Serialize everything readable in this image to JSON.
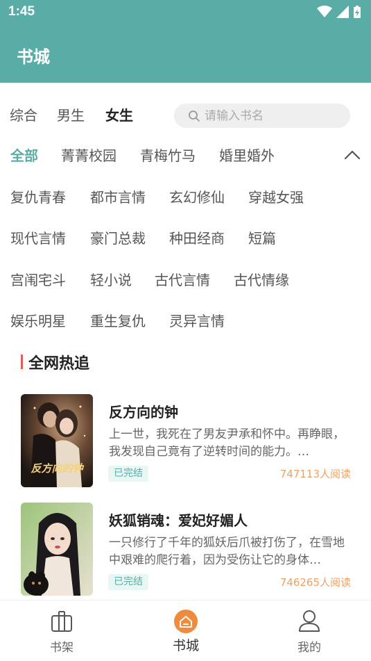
{
  "status_bar": {
    "time": "1:45"
  },
  "app_bar": {
    "title": "书城"
  },
  "tabs": [
    {
      "label": "综合",
      "active": false
    },
    {
      "label": "男生",
      "active": false
    },
    {
      "label": "女生",
      "active": true
    }
  ],
  "search": {
    "placeholder": "请输入书名"
  },
  "categories": [
    [
      "全部",
      "菁菁校园",
      "青梅竹马",
      "婚里婚外"
    ],
    [
      "复仇青春",
      "都市言情",
      "玄幻修仙",
      "穿越女强"
    ],
    [
      "现代言情",
      "豪门总裁",
      "种田经商",
      "短篇"
    ],
    [
      "宫闱宅斗",
      "轻小说",
      "古代言情",
      "古代情缘"
    ],
    [
      "娱乐明星",
      "重生复仇",
      "灵异言情"
    ]
  ],
  "section": {
    "title": "全网热追"
  },
  "books": [
    {
      "title": "反方向的钟",
      "description": "上一世，我死在了男友尹承和怀中。再睁眼，我发现自己竟有了逆转时间的能力。…",
      "status": "已完结",
      "reads": "747113人阅读",
      "cover_text": "反方向的钟"
    },
    {
      "title": "妖狐销魂：爱妃好媚人",
      "description": "一只修行了千年的狐妖后爪被打伤了，在雪地中艰难的爬行着，因为受伤让它的身体…",
      "status": "已完结",
      "reads": "746265人阅读"
    }
  ],
  "bottom_nav": [
    {
      "label": "书架",
      "icon": "bookshelf-icon"
    },
    {
      "label": "书城",
      "icon": "home-icon",
      "active": true
    },
    {
      "label": "我的",
      "icon": "profile-icon"
    }
  ],
  "colors": {
    "primary": "#5aaca6",
    "accent_orange": "#f0a060",
    "status_bg": "#e8f6f4",
    "section_bar": "#e85a5a"
  }
}
